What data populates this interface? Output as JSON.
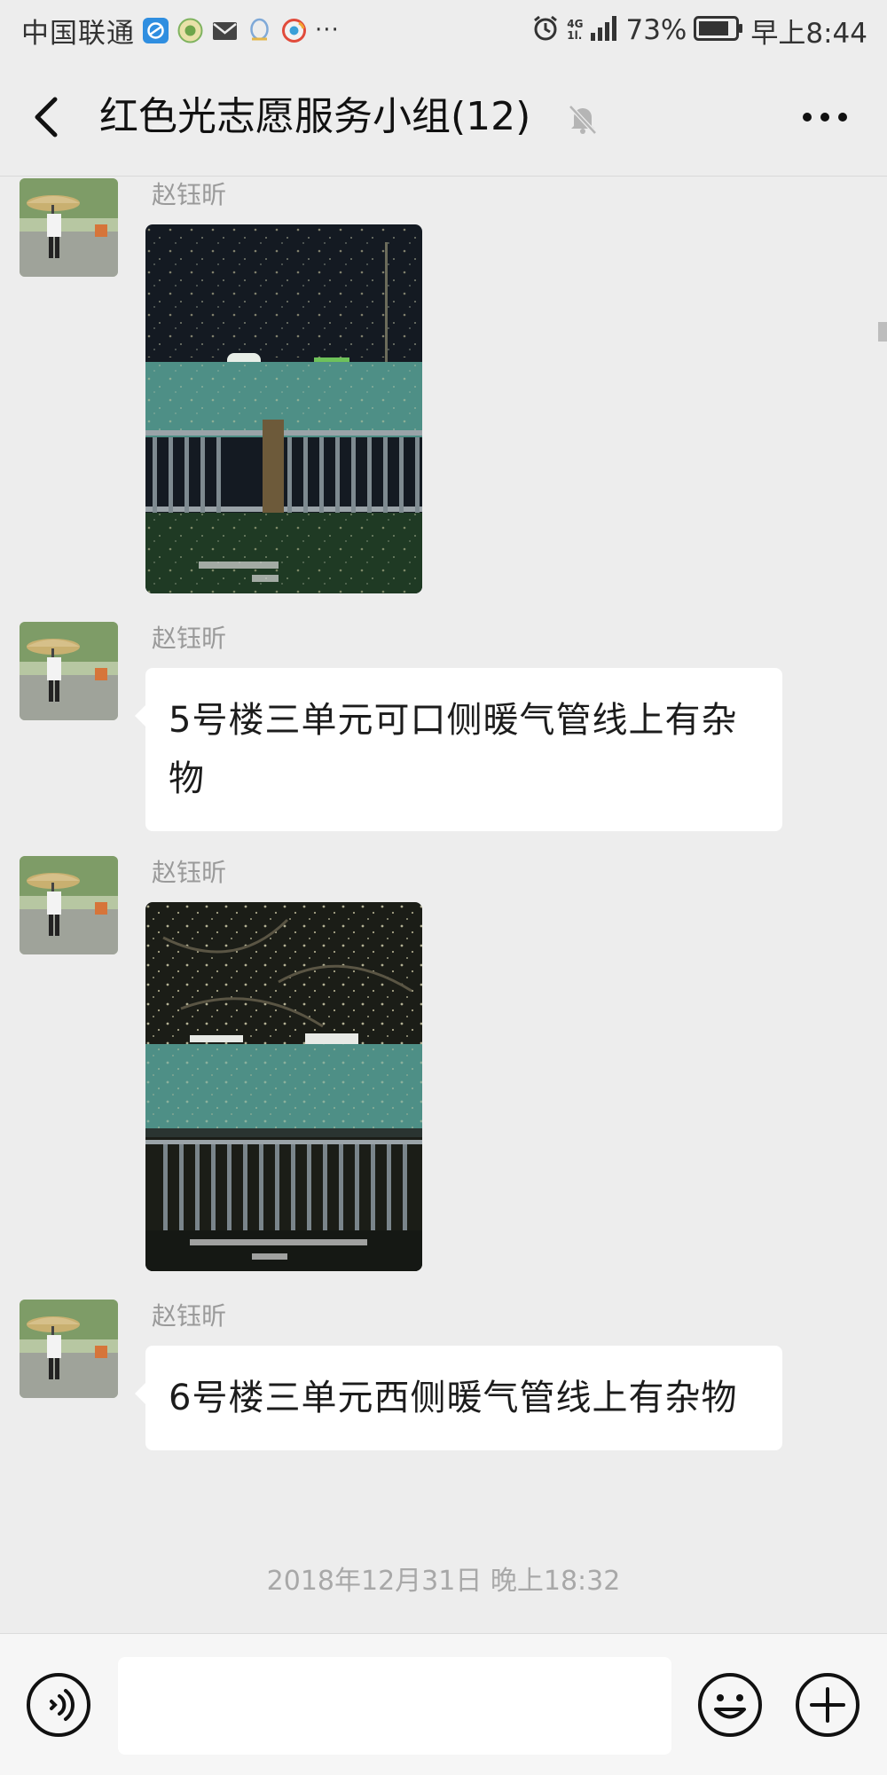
{
  "status_bar": {
    "carrier": "中国联通",
    "more_indicator": "···",
    "network_label_top": "4G",
    "network_label_bottom": "1l.",
    "battery_percent": "73%",
    "time": "早上8:44",
    "icons": [
      "browser-icon",
      "wechat-mini-icon",
      "mail-icon",
      "qq-icon",
      "weibo-icon",
      "alarm-icon",
      "signal-icon",
      "battery-icon"
    ]
  },
  "header": {
    "title": "红色光志愿服务小组(12)",
    "icons": [
      "back-arrow-icon",
      "mute-bell-icon",
      "more-dots-icon"
    ]
  },
  "messages": [
    {
      "type": "image",
      "sender": "赵钰昕",
      "image_desc": "night-photo-heating-pipe-fence"
    },
    {
      "type": "text",
      "sender": "赵钰昕",
      "text": "5号楼三单元可口侧暖气管线上有杂物"
    },
    {
      "type": "image",
      "sender": "赵钰昕",
      "image_desc": "night-photo-pipe-over-railing"
    },
    {
      "type": "text",
      "sender": "赵钰昕",
      "text": "6号楼三单元西侧暖气管线上有杂物"
    }
  ],
  "timestamp": "2018年12月31日 晚上18:32",
  "input_bar": {
    "placeholder": "",
    "icons": [
      "voice-icon",
      "emoji-icon",
      "plus-icon"
    ]
  },
  "colors": {
    "background": "#ededed",
    "bubble": "#ffffff",
    "sender_text": "#9a9a9a",
    "timestamp_text": "#a8a8a8",
    "pipe_teal": "#4e8f86"
  }
}
